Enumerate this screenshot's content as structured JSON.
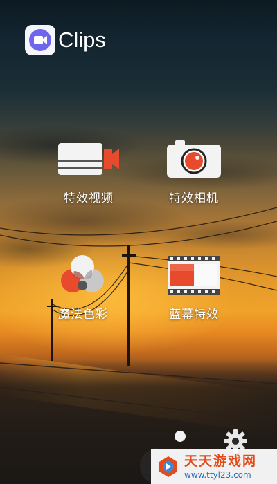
{
  "app": {
    "title": "Clips",
    "logo_icon": "video-camera-icon",
    "logo_accent": "#7a6cf0"
  },
  "tiles": [
    {
      "label": "特效视频",
      "icon": "video-effects-icon"
    },
    {
      "label": "特效相机",
      "icon": "camera-icon"
    },
    {
      "label": "魔法色彩",
      "icon": "color-circles-icon"
    },
    {
      "label": "蓝幕特效",
      "icon": "filmstrip-icon"
    }
  ],
  "bottom": {
    "dot_icon": "page-dot-icon",
    "gear_icon": "gear-icon"
  },
  "watermark": {
    "title": "天天游戏网",
    "url": "www.ttyl23.com"
  },
  "colors": {
    "accent_red": "#e84a2e",
    "tile_white": "#f5f5f5"
  }
}
